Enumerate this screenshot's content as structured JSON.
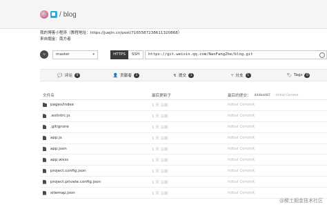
{
  "breadcrumb": {
    "separator": "/",
    "repo_name": "blog"
  },
  "description": {
    "line1": "我的博客小程序（教程地址：https://juejin.cn/post/7165587238611320868）",
    "line2": "来自掘金：南方者"
  },
  "repo_bar": {
    "branch_icon": "branch-icon",
    "branch": "master",
    "protocols": {
      "https": "HTTPS",
      "ssh": "SSH",
      "active": "HTTPS"
    },
    "clone_url": "https://git.weixin.qq.com/NanFangZhe/blog.git"
  },
  "stats": [
    {
      "icon": "comment-icon",
      "glyph": "💬",
      "label": "评论",
      "count": "0"
    },
    {
      "icon": "user-icon",
      "glyph": "👤",
      "label": "贡献者",
      "count": "1"
    },
    {
      "icon": "commit-icon",
      "glyph": "↯",
      "label": "提交",
      "count": "1"
    },
    {
      "icon": "branch-icon",
      "glyph": "⑂",
      "label": "分支",
      "count": "1"
    },
    {
      "icon": "tag-icon",
      "glyph": "🏷",
      "label": "Tags",
      "count": "0"
    }
  ],
  "table": {
    "headers": {
      "name": "文件名",
      "time": "最后更新于",
      "last_commit": "最后的提交：",
      "commit_hash": "44dbdd87",
      "commit_label": "- Initial Commit"
    },
    "rows": [
      {
        "type": "folder",
        "name": "pages/index",
        "time": "1 天 以前",
        "message": "Initial Commit"
      },
      {
        "type": "file",
        "name": ".eslintrc.js",
        "time": "1 天 以前",
        "message": "Initial Commit"
      },
      {
        "type": "file",
        "name": ".gitignore",
        "time": "1 天 以前",
        "message": "Initial Commit"
      },
      {
        "type": "file",
        "name": "app.js",
        "time": "1 天 以前",
        "message": "Initial Commit"
      },
      {
        "type": "file",
        "name": "app.json",
        "time": "1 天 以前",
        "message": "Initial Commit"
      },
      {
        "type": "file",
        "name": "app.wxss",
        "time": "1 天 以前",
        "message": "Initial Commit"
      },
      {
        "type": "file",
        "name": "project.config.json",
        "time": "1 天 以前",
        "message": "Initial Commit"
      },
      {
        "type": "file",
        "name": "project.private.config.json",
        "time": "1 天 以前",
        "message": "Initial Commit"
      },
      {
        "type": "file",
        "name": "sitemap.json",
        "time": "1 天 以前",
        "message": "Initial Commit"
      }
    ]
  },
  "watermark": "@稀土掘金技术社区"
}
